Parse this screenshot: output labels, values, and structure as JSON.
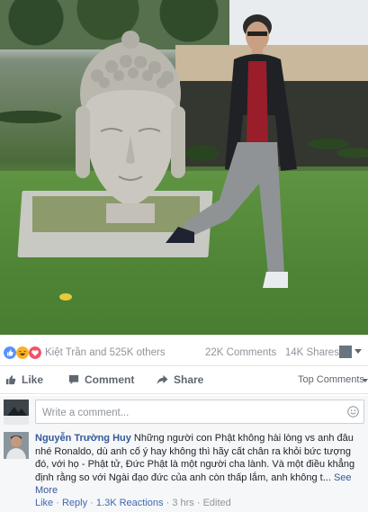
{
  "photo": {
    "icon": "photo-buddha-man"
  },
  "reactions": {
    "icons": [
      "like-icon",
      "haha-icon",
      "love-icon"
    ],
    "colors": {
      "like": "#5890ff",
      "haha": "#f7b125",
      "love": "#f25268"
    },
    "summary": "Kiệt Trần and 525K others",
    "comments_count": "22K Comments",
    "shares_count": "14K Shares"
  },
  "actions": {
    "like": "Like",
    "comment": "Comment",
    "share": "Share",
    "sort": "Top Comments"
  },
  "composer": {
    "placeholder": "Write a comment..."
  },
  "comment": {
    "author": "Nguyễn Trường Huy",
    "text": "Những người con Phật không hài lòng vs anh đâu nhé Ronaldo, dù anh cố ý hay không thì hãy cất chân ra khỏi bức tượng đó, với họ - Phật tử, Đức Phật là một người cha lành. Và một điều khẳng định rằng so với Ngài đạo đức của anh còn thấp lắm, anh không t...",
    "see_more": "See More",
    "meta": {
      "like": "Like",
      "reply": "Reply",
      "reactions": "1.3K Reactions",
      "time": "3 hrs",
      "edited": "Edited"
    }
  },
  "colors": {
    "link": "#365899",
    "muted": "#90949c",
    "action": "#606770"
  }
}
